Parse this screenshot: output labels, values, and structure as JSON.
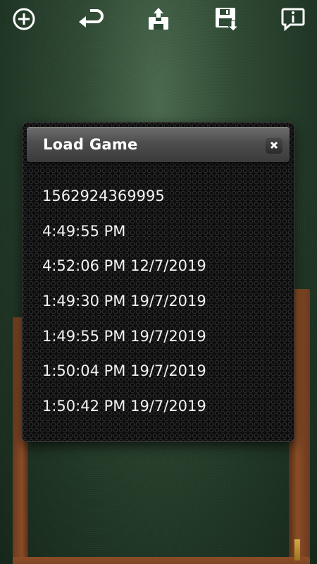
{
  "toolbar": {
    "buttons": [
      {
        "icon": "add-circle-icon"
      },
      {
        "icon": "undo-icon"
      },
      {
        "icon": "load-game-icon"
      },
      {
        "icon": "save-game-icon"
      },
      {
        "icon": "info-icon"
      }
    ]
  },
  "dialog": {
    "title": "Load Game",
    "saves": [
      "1562924369995",
      "4:49:55 PM",
      "4:52:06 PM 12/7/2019",
      "1:49:30 PM 19/7/2019",
      "1:49:55 PM 19/7/2019",
      "1:50:04 PM 19/7/2019",
      "1:50:42 PM 19/7/2019"
    ]
  },
  "colors": {
    "felt": "#2f4a34",
    "dialog_bg": "#0c0c0c",
    "header": "#4d4d4d",
    "text": "#f2f2f2"
  }
}
